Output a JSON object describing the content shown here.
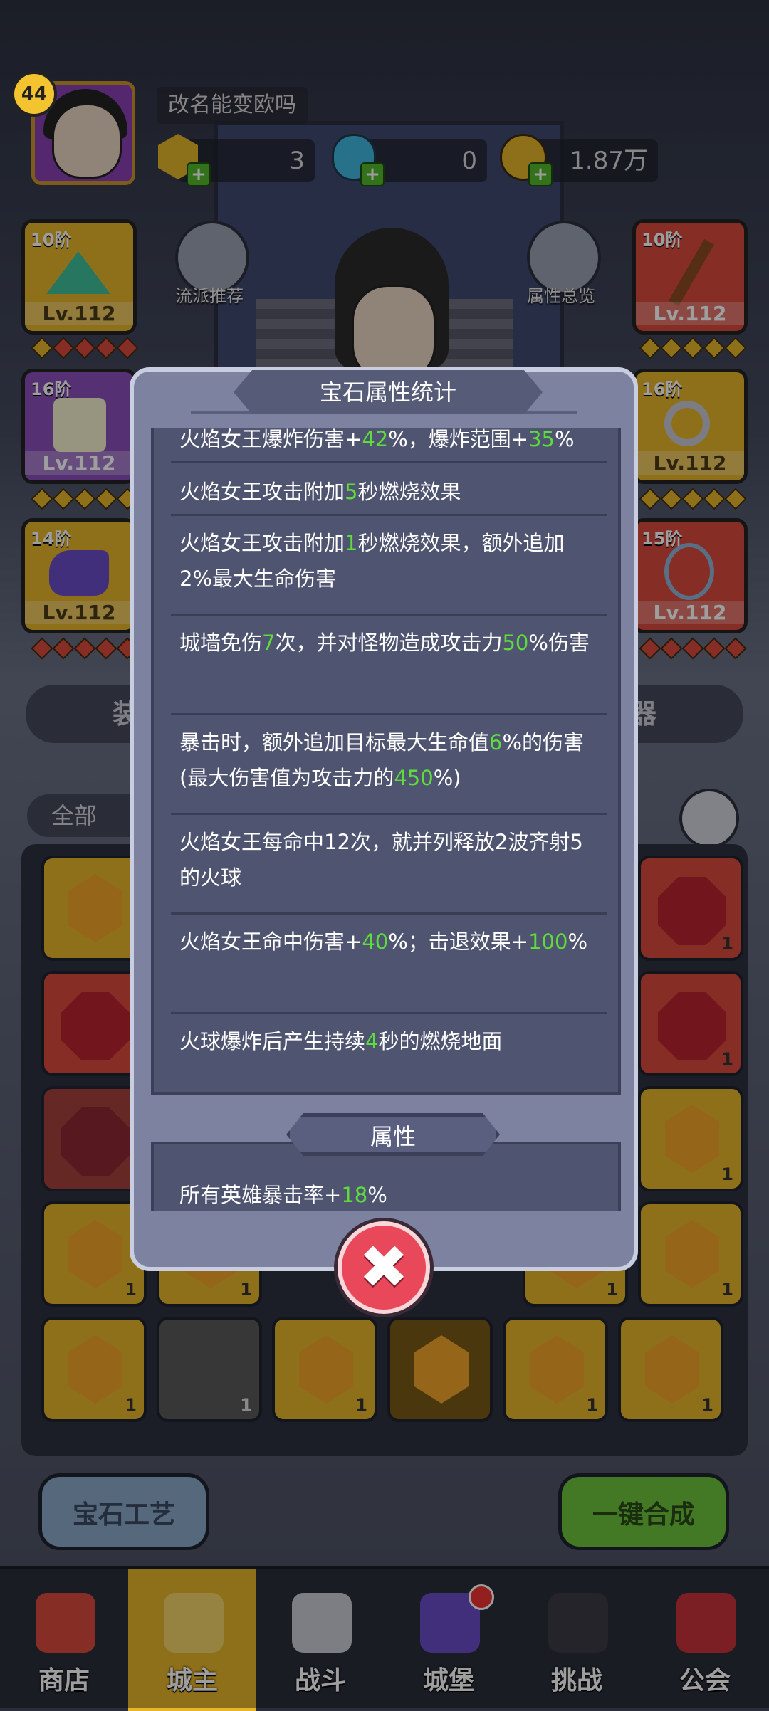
{
  "player": {
    "level": "44",
    "name": "改名能变欧吗"
  },
  "currencies": [
    {
      "icon": "gold-gem-icon",
      "value": "3"
    },
    {
      "icon": "potion-icon",
      "value": "0"
    },
    {
      "icon": "gold-coin-icon",
      "value": "1.87万"
    }
  ],
  "equipment": [
    {
      "tier": "10阶",
      "level": "Lv.112",
      "icon": "wizard-hat-icon"
    },
    {
      "tier": "16阶",
      "level": "Lv.112",
      "icon": "robe-icon"
    },
    {
      "tier": "14阶",
      "level": "Lv.112",
      "icon": "boots-icon"
    },
    {
      "tier": "10阶",
      "level": "Lv.112",
      "icon": "staff-icon"
    },
    {
      "tier": "16阶",
      "level": "Lv.112",
      "icon": "ring-icon"
    },
    {
      "tier": "15阶",
      "level": "Lv.112",
      "icon": "necklace-icon"
    }
  ],
  "quick_buttons": {
    "build_recommend": "流派推荐",
    "attr_overview": "属性总览"
  },
  "tabs": {
    "equipment": "装备",
    "artifact": "神器"
  },
  "filter": {
    "label": "全部"
  },
  "grid_counts": [
    "1",
    "1",
    "1",
    "1",
    "1",
    "1",
    "1",
    "1",
    "1",
    "1",
    "1",
    "1"
  ],
  "actions": {
    "gem_craft": "宝石工艺",
    "one_key_merge": "一键合成"
  },
  "nav": [
    {
      "label": "商店",
      "icon": "shop-icon"
    },
    {
      "label": "城主",
      "icon": "crown-icon"
    },
    {
      "label": "战斗",
      "icon": "crossed-swords-icon"
    },
    {
      "label": "城堡",
      "icon": "castle-icon"
    },
    {
      "label": "挑战",
      "icon": "demon-icon"
    },
    {
      "label": "公会",
      "icon": "guild-banner-icon"
    }
  ],
  "modal": {
    "title": "宝石属性统计",
    "effects": [
      {
        "parts": [
          [
            "火焰女王爆炸伤害+",
            false
          ],
          [
            "42",
            true
          ],
          [
            "%，爆炸范围+",
            false
          ],
          [
            "35",
            true
          ],
          [
            "%",
            false
          ]
        ]
      },
      {
        "parts": [
          [
            "火焰女王攻击附加",
            false
          ],
          [
            "5",
            true
          ],
          [
            "秒燃烧效果",
            false
          ]
        ]
      },
      {
        "parts": [
          [
            "火焰女王攻击附加",
            false
          ],
          [
            "1",
            true
          ],
          [
            "秒燃烧效果，额外追加2%最大生命伤害",
            false
          ]
        ]
      },
      {
        "parts": [
          [
            "城墙免伤",
            false
          ],
          [
            "7",
            true
          ],
          [
            "次，并对怪物造成攻击力",
            false
          ],
          [
            "50",
            true
          ],
          [
            "%伤害",
            false
          ]
        ]
      },
      {
        "parts": [
          [
            "暴击时，额外追加目标最大生命值",
            false
          ],
          [
            "6",
            true
          ],
          [
            "%的伤害(最大伤害值为攻击力的",
            false
          ],
          [
            "450",
            true
          ],
          [
            "%)",
            false
          ]
        ]
      },
      {
        "parts": [
          [
            "火焰女王每命中12次，就并列释放2波齐射5的火球",
            false
          ]
        ]
      },
      {
        "parts": [
          [
            "火焰女王命中伤害+",
            false
          ],
          [
            "40",
            true
          ],
          [
            "%；击退效果+",
            false
          ],
          [
            "100",
            true
          ],
          [
            "%",
            false
          ]
        ]
      },
      {
        "parts": [
          [
            "火球爆炸后产生持续",
            false
          ],
          [
            "4",
            true
          ],
          [
            "秒的燃烧地面",
            false
          ]
        ]
      }
    ],
    "attributes_label": "属性",
    "attributes": [
      {
        "parts": [
          [
            "所有英雄暴击率+",
            false
          ],
          [
            "18",
            true
          ],
          [
            "%",
            false
          ]
        ]
      }
    ]
  },
  "colors": {
    "highlight": "#5ddc3c",
    "modal_bg": "#7d82a1",
    "panel_bg": "#4f5470",
    "close": "#e9485b"
  }
}
